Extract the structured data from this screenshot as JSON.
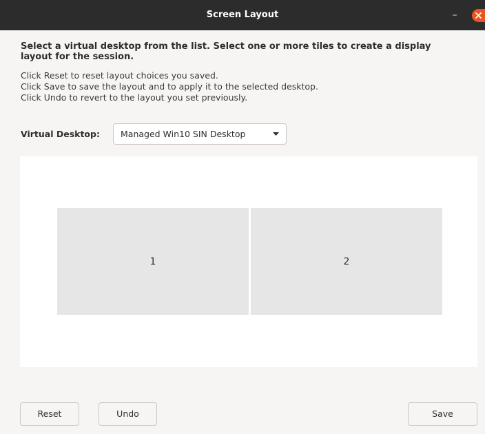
{
  "window": {
    "title": "Screen Layout",
    "minimize_glyph": "–"
  },
  "instructions": {
    "heading": "Select a virtual desktop from the list. Select one or more tiles to create a display layout for the session.",
    "lines": [
      "Click Reset to reset layout choices you saved.",
      "Click Save to save the layout and to apply it to the selected desktop.",
      "Click Undo to revert to the layout you set previously."
    ]
  },
  "virtual_desktop": {
    "label": "Virtual Desktop:",
    "selected": "Managed Win10 SIN Desktop"
  },
  "tiles": [
    {
      "label": "1"
    },
    {
      "label": "2"
    }
  ],
  "buttons": {
    "reset": "Reset",
    "undo": "Undo",
    "save": "Save"
  },
  "colors": {
    "titlebar": "#2c2c2c",
    "close_button": "#e95420",
    "background": "#f6f5f4",
    "tile": "#e6e6e6"
  },
  "icons": {
    "close": "close-icon",
    "dropdown": "chevron-down-icon"
  }
}
